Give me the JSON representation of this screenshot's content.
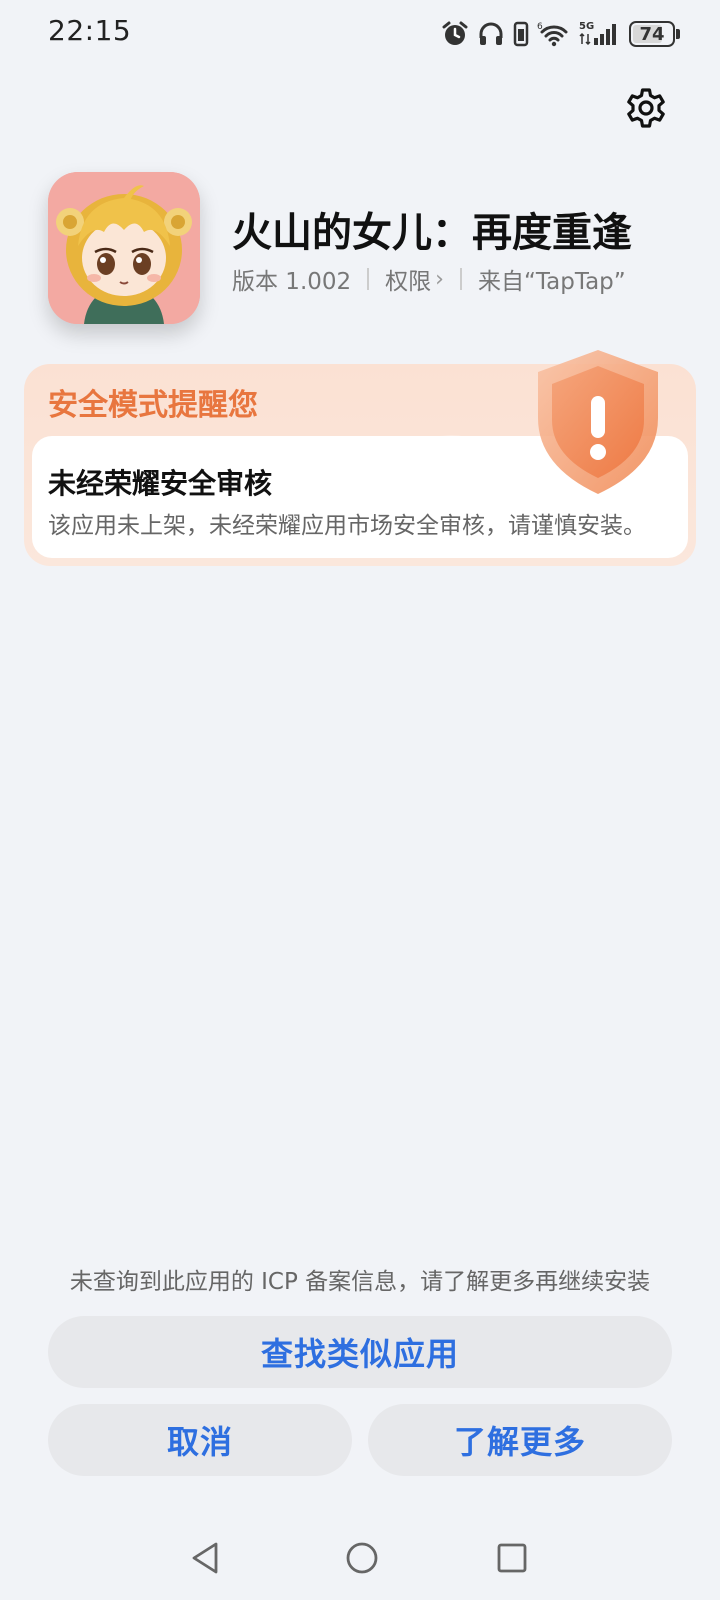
{
  "status_bar": {
    "time": "22:15",
    "battery": "74",
    "network": "5G",
    "icons": [
      "alarm-icon",
      "headphones-icon",
      "vibrate-icon",
      "wifi-icon",
      "signal-icon",
      "battery-icon"
    ]
  },
  "app": {
    "name": "火山的女儿：再度重逢",
    "version": "版本 1.002",
    "permissions": "权限",
    "source": "来自“TapTap”"
  },
  "warning": {
    "title": "安全模式提醒您",
    "subtitle": "未经荣耀安全审核",
    "description": "该应用未上架，未经荣耀应用市场安全审核，请谨慎安装。"
  },
  "footer": {
    "icp_notice": "未查询到此应用的 ICP 备案信息，请了解更多再继续安装",
    "find_similar": "查找类似应用",
    "cancel": "取消",
    "learn_more": "了解更多"
  },
  "colors": {
    "accent": "#2e6fe0",
    "warning": "#e8763f",
    "background": "#f1f3f7"
  }
}
